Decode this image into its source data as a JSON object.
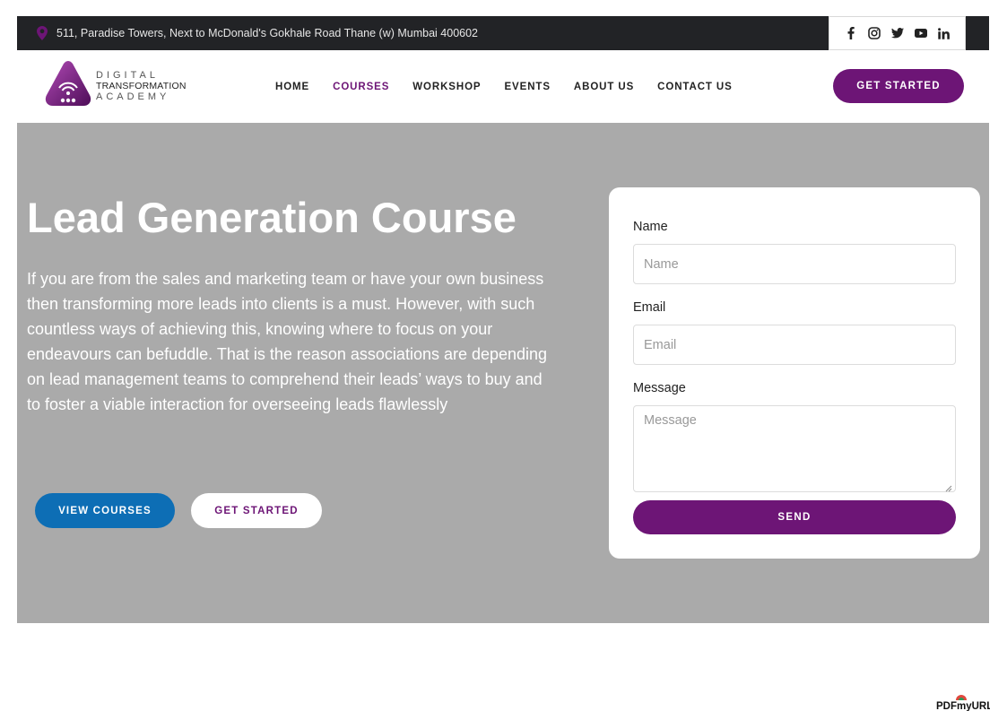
{
  "topbar": {
    "address": "511, Paradise Towers, Next to McDonald's Gokhale Road Thane (w) Mumbai 400602",
    "social_icons": [
      "facebook-icon",
      "instagram-icon",
      "twitter-icon",
      "youtube-icon",
      "linkedin-icon"
    ]
  },
  "logo": {
    "line1": "DIGITAL",
    "line2": "TRANSFORMATION",
    "line3": "ACADEMY"
  },
  "nav": {
    "items": [
      {
        "label": "HOME"
      },
      {
        "label": "COURSES",
        "active": true
      },
      {
        "label": "WORKSHOP"
      },
      {
        "label": "EVENTS"
      },
      {
        "label": "ABOUT US"
      },
      {
        "label": "CONTACT US"
      }
    ],
    "cta_label": "GET STARTED"
  },
  "hero": {
    "title": "Lead Generation Course",
    "description": "If you are from the sales and marketing team or have your own business then transforming more leads into clients is a must. However, with such countless ways of achieving this, knowing where to focus on your endeavours can befuddle. That is the reason associations are depending on lead management teams to comprehend their leads’ ways to buy and to foster a viable interaction for overseeing leads flawlessly",
    "view_courses_label": "VIEW COURSES",
    "get_started_label": "GET STARTED"
  },
  "form": {
    "name_label": "Name",
    "name_placeholder": "Name",
    "email_label": "Email",
    "email_placeholder": "Email",
    "message_label": "Message",
    "message_placeholder": "Message",
    "send_label": "SEND"
  },
  "watermark": "PDFmyURL",
  "colors": {
    "brand_purple": "#6d1576",
    "blue": "#0d6eb5",
    "topbar_bg": "#222326",
    "hero_bg": "#aaaaaa"
  }
}
